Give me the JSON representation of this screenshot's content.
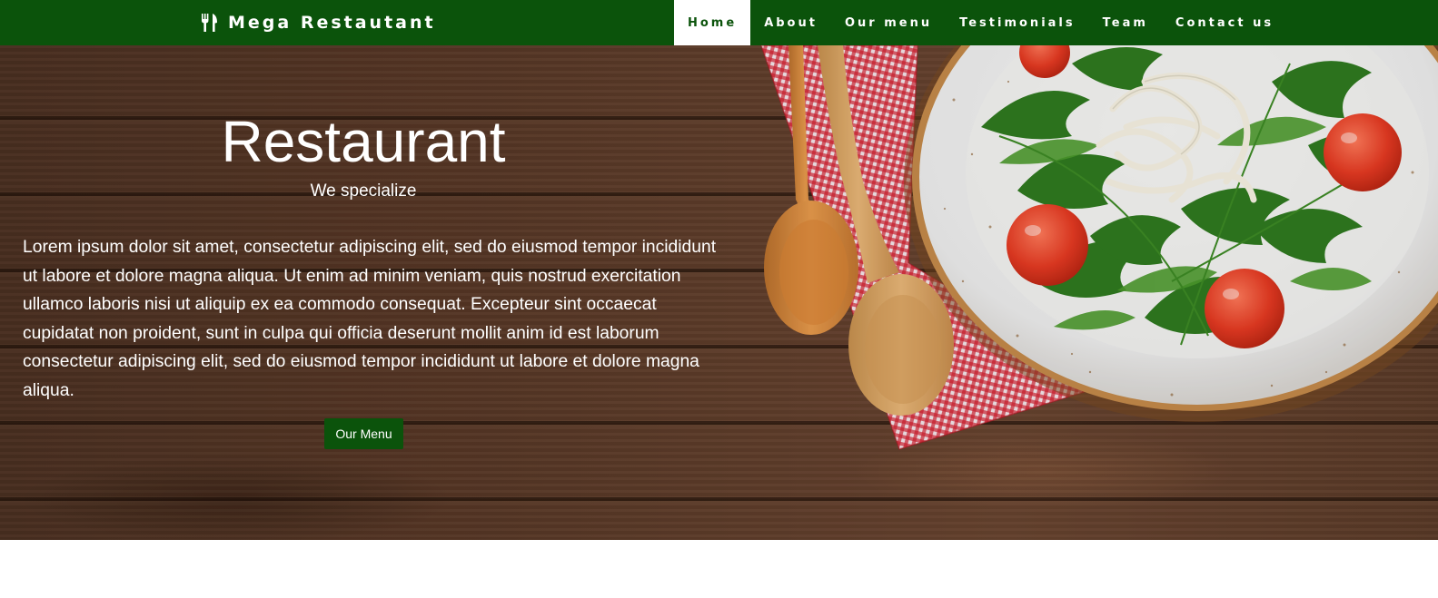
{
  "navbar": {
    "brand": {
      "icon": "utensils-icon",
      "label": "Mega Restautant"
    },
    "items": [
      {
        "label": "Home",
        "active": true
      },
      {
        "label": "About"
      },
      {
        "label": "Our menu"
      },
      {
        "label": "Testimonials"
      },
      {
        "label": "Team"
      },
      {
        "label": "Contact us"
      }
    ]
  },
  "hero": {
    "title": "Restaurant",
    "subtitle": "We specialize",
    "text": "Lorem ipsum dolor sit amet, consectetur adipiscing elit, sed do eiusmod tempor incididunt ut labore et dolore magna aliqua. Ut enim ad minim veniam, quis nostrud exercitation ullamco laboris nisi ut aliquip ex ea commodo consequat. Excepteur sint occaecat cupidatat non proident, sunt in culpa qui officia deserunt mollit anim id est laborum consectetur adipiscing elit, sed do eiusmod tempor incididunt ut labore et dolore magna aliqua.",
    "button_label": "Our Menu",
    "image": "salad-plate-with-wooden-spoons-on-wood-table"
  },
  "colors": {
    "brand_green": "#0b530b",
    "nav_active_bg": "#ffffff",
    "wood_brown": "#5b3a28"
  }
}
